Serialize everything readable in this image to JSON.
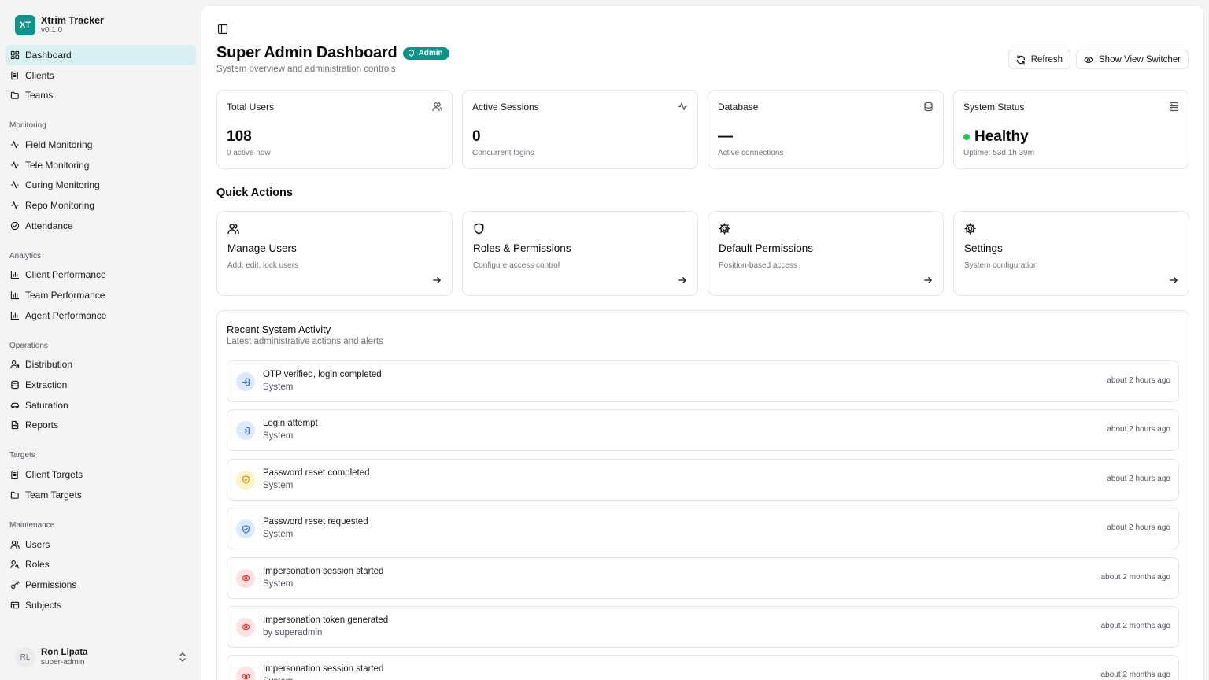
{
  "app": {
    "name": "Xtrim Tracker",
    "version": "v0.1.0",
    "logo_initials": "XT",
    "accent_color": "#0d9488"
  },
  "sidebar": {
    "top_items": [
      {
        "label": "Dashboard",
        "icon": "dashboard-icon",
        "active": true
      },
      {
        "label": "Clients",
        "icon": "building-icon"
      },
      {
        "label": "Teams",
        "icon": "folder-icon"
      }
    ],
    "groups": [
      {
        "label": "Monitoring",
        "items": [
          {
            "label": "Field Monitoring",
            "icon": "activity-icon"
          },
          {
            "label": "Tele Monitoring",
            "icon": "activity-icon"
          },
          {
            "label": "Curing Monitoring",
            "icon": "activity-icon"
          },
          {
            "label": "Repo Monitoring",
            "icon": "activity-icon"
          },
          {
            "label": "Attendance",
            "icon": "check-circle-icon"
          }
        ]
      },
      {
        "label": "Analytics",
        "items": [
          {
            "label": "Client Performance",
            "icon": "bar-chart-icon"
          },
          {
            "label": "Team Performance",
            "icon": "bar-chart-icon"
          },
          {
            "label": "Agent Performance",
            "icon": "bar-chart-icon"
          }
        ]
      },
      {
        "label": "Operations",
        "items": [
          {
            "label": "Distribution",
            "icon": "user-share-icon"
          },
          {
            "label": "Extraction",
            "icon": "database-icon"
          },
          {
            "label": "Saturation",
            "icon": "car-icon"
          },
          {
            "label": "Reports",
            "icon": "file-icon"
          }
        ]
      },
      {
        "label": "Targets",
        "items": [
          {
            "label": "Client Targets",
            "icon": "building-icon"
          },
          {
            "label": "Team Targets",
            "icon": "folder-icon"
          }
        ]
      },
      {
        "label": "Maintenance",
        "items": [
          {
            "label": "Users",
            "icon": "users-icon"
          },
          {
            "label": "Roles",
            "icon": "user-key-icon"
          },
          {
            "label": "Permissions",
            "icon": "key-icon"
          },
          {
            "label": "Subjects",
            "icon": "layout-icon"
          }
        ]
      }
    ],
    "user": {
      "initials": "RL",
      "name": "Ron Lipata",
      "role": "super-admin"
    }
  },
  "header": {
    "title": "Super Admin Dashboard",
    "badge": "Admin",
    "subtitle": "System overview and administration controls",
    "refresh_label": "Refresh",
    "view_switcher_label": "Show View Switcher"
  },
  "stats": [
    {
      "label": "Total Users",
      "value": "108",
      "sub": "0 active now",
      "icon": "users-icon"
    },
    {
      "label": "Active Sessions",
      "value": "0",
      "sub": "Concurrent logins",
      "icon": "activity-icon"
    },
    {
      "label": "Database",
      "value": "—",
      "sub": "Active connections",
      "icon": "database-icon"
    },
    {
      "label": "System Status",
      "value": "Healthy",
      "sub": "Uptime: 53d 1h 39m",
      "icon": "server-icon",
      "status_color": "#22c55e"
    }
  ],
  "quick_actions": {
    "title": "Quick Actions",
    "items": [
      {
        "title": "Manage Users",
        "desc": "Add, edit, lock users",
        "icon": "users-icon"
      },
      {
        "title": "Roles & Permissions",
        "desc": "Configure access control",
        "icon": "shield-icon"
      },
      {
        "title": "Default Permissions",
        "desc": "Position-based access",
        "icon": "gear-icon"
      },
      {
        "title": "Settings",
        "desc": "System configuration",
        "icon": "gear-icon"
      }
    ]
  },
  "activity": {
    "title": "Recent System Activity",
    "subtitle": "Latest administrative actions and alerts",
    "items": [
      {
        "name": "OTP verified, login completed",
        "actor": "System",
        "time": "about 2 hours ago",
        "icon": "login-icon",
        "tone": "blue"
      },
      {
        "name": "Login attempt",
        "actor": "System",
        "time": "about 2 hours ago",
        "icon": "login-icon",
        "tone": "blue"
      },
      {
        "name": "Password reset completed",
        "actor": "System",
        "time": "about 2 hours ago",
        "icon": "shield-check-icon",
        "tone": "yellow"
      },
      {
        "name": "Password reset requested",
        "actor": "System",
        "time": "about 2 hours ago",
        "icon": "shield-check-icon",
        "tone": "blue"
      },
      {
        "name": "Impersonation session started",
        "actor": "System",
        "time": "about 2 months ago",
        "icon": "eye-icon",
        "tone": "red"
      },
      {
        "name": "Impersonation token generated",
        "actor": "by superadmin",
        "time": "about 2 months ago",
        "icon": "eye-icon",
        "tone": "red"
      },
      {
        "name": "Impersonation session started",
        "actor": "System",
        "time": "about 2 months ago",
        "icon": "eye-icon",
        "tone": "red"
      }
    ]
  },
  "tone_colors": {
    "blue": {
      "bg": "#dbeafe",
      "fg": "#2563eb"
    },
    "yellow": {
      "bg": "#fef3c7",
      "fg": "#ca8a04"
    },
    "red": {
      "bg": "#fee2e2",
      "fg": "#dc2626"
    }
  }
}
